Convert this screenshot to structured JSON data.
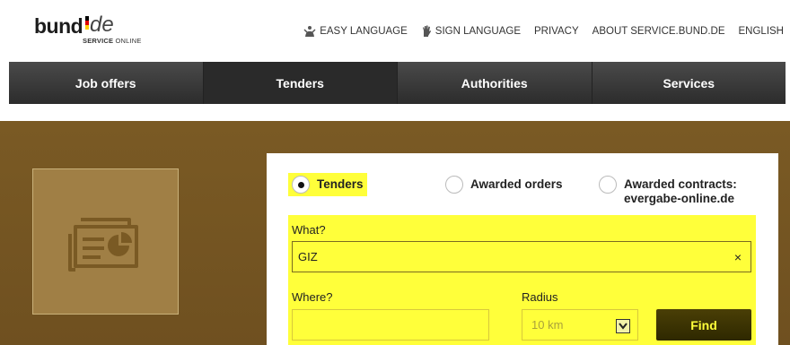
{
  "logo": {
    "word": "bund",
    "suffix": "de",
    "sub_bold": "SERVICE",
    "sub_rest": "ONLINE"
  },
  "topnav": [
    {
      "icon": "easy-language-icon",
      "label": "EASY LANGUAGE"
    },
    {
      "icon": "sign-language-icon",
      "label": "SIGN LANGUAGE"
    },
    {
      "label": "PRIVACY"
    },
    {
      "label": "ABOUT SERVICE.BUND.DE"
    },
    {
      "label": "ENGLISH"
    }
  ],
  "mainnav": [
    {
      "label": "Job offers"
    },
    {
      "label": "Tenders",
      "active": true
    },
    {
      "label": "Authorities"
    },
    {
      "label": "Services"
    }
  ],
  "search": {
    "options": [
      {
        "label": "Tenders",
        "selected": true
      },
      {
        "label": "Awarded orders",
        "selected": false
      },
      {
        "label_line1": "Awarded contracts:",
        "label_line2": "evergabe-online.de",
        "selected": false
      }
    ],
    "what_label": "What?",
    "what_value": "GIZ",
    "clear_symbol": "×",
    "where_label": "Where?",
    "where_value": "",
    "radius_label": "Radius",
    "radius_value": "10 km",
    "find_label": "Find"
  },
  "colors": {
    "highlight": "#ffff3a",
    "hero": "#7a5a24",
    "nav": "#333333"
  }
}
